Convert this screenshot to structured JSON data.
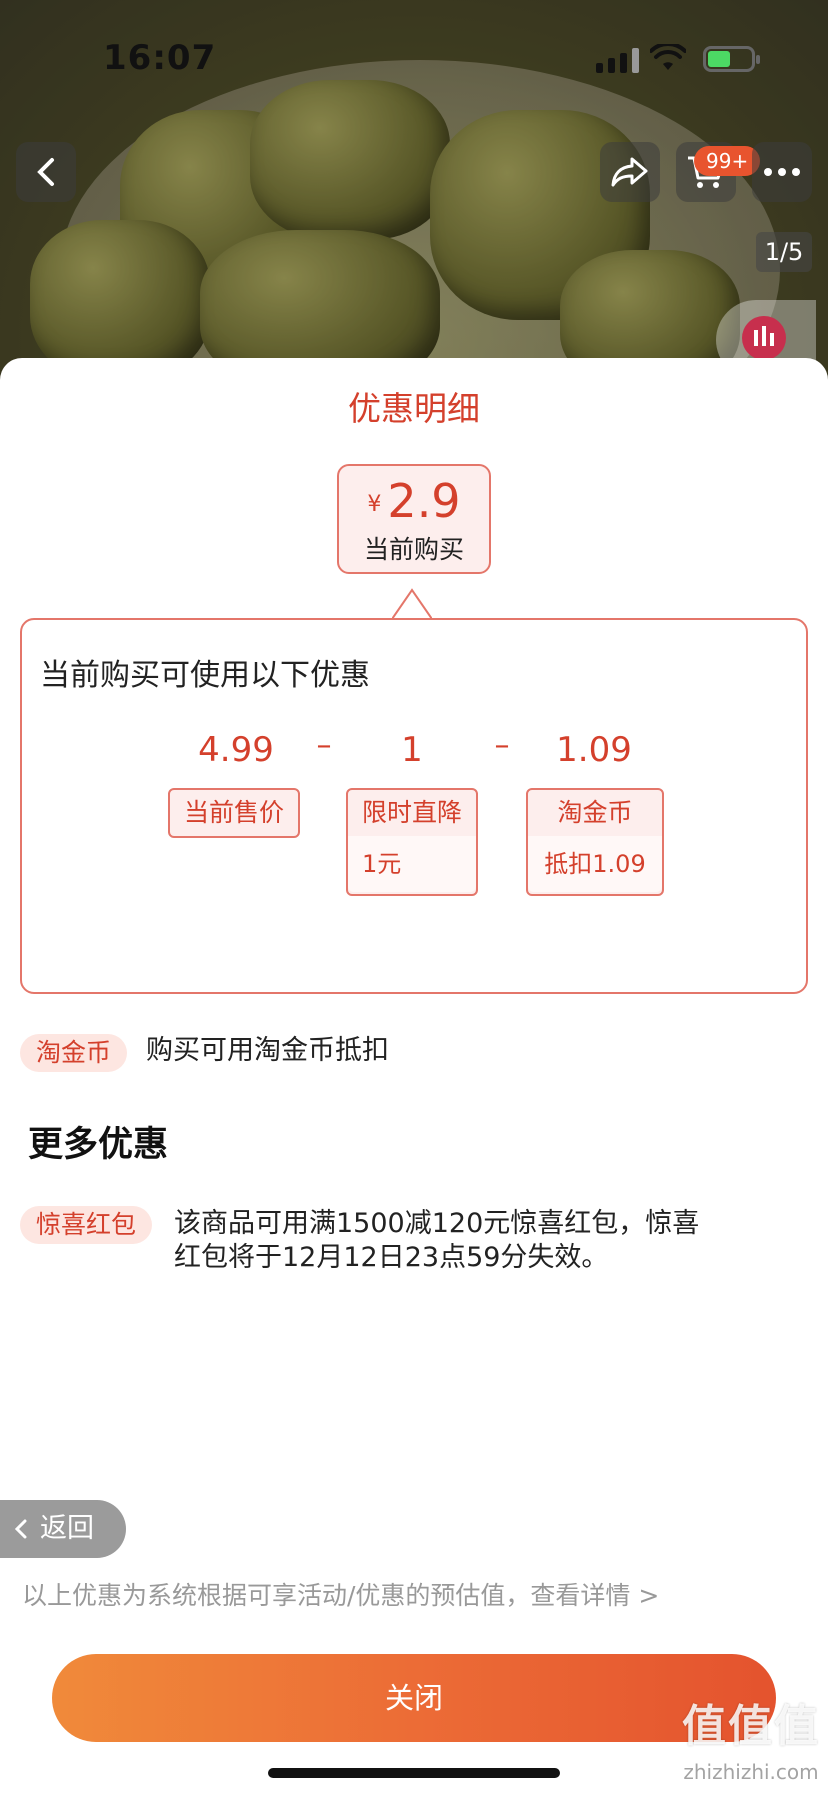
{
  "status_bar": {
    "time": "16:07"
  },
  "top_nav": {
    "back_icon": "chevron-left-icon",
    "share_icon": "share-icon",
    "cart_icon": "cart-icon",
    "cart_badge": "99+",
    "more_icon": "more-dots-icon",
    "page_indicator": "1/5"
  },
  "sheet": {
    "title": "优惠明细",
    "current_price": {
      "currency": "¥",
      "amount": "2.9",
      "label": "当前购买"
    },
    "panel": {
      "heading": "当前购买可使用以下优惠",
      "calc": [
        {
          "value": "4.99",
          "tag": "当前售价",
          "detail": ""
        },
        {
          "value": "1",
          "tag": "限时直降",
          "detail": "1元"
        },
        {
          "value": "1.09",
          "tag": "淘金币",
          "detail": "抵扣1.09"
        }
      ],
      "operators": [
        "–",
        "–"
      ]
    },
    "coin_row": {
      "tag": "淘金币",
      "text": "购买可用淘金币抵扣"
    },
    "more_title": "更多优惠",
    "surprise_row": {
      "tag": "惊喜红包",
      "text_line1": "该商品可用满1500减120元惊喜红包，惊喜",
      "text_line2": "红包将于12月12日23点59分失效。"
    },
    "back_label": "返回",
    "disclaimer": "以上优惠为系统根据可享活动/优惠的预估值，查看详情 >",
    "close_label": "关闭"
  },
  "watermark": {
    "big": "值值值",
    "small": "zhizhizhi.com"
  },
  "colors": {
    "accent": "#d4402c",
    "button_start": "#f08a3a",
    "button_end": "#e4532e"
  }
}
